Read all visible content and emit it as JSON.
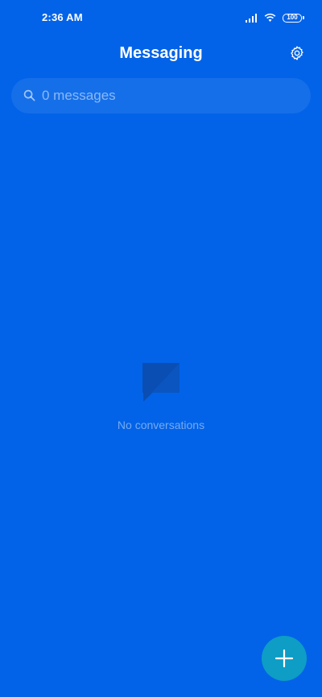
{
  "status_bar": {
    "time": "2:36 AM",
    "battery_level": "100",
    "icons": [
      "signal-icon",
      "wifi-icon",
      "battery-icon"
    ]
  },
  "header": {
    "title": "Messaging",
    "settings_icon": "gear-icon"
  },
  "search": {
    "placeholder": "0 messages",
    "icon": "search-icon"
  },
  "empty_state": {
    "icon": "message-bubble-icon",
    "text": "No conversations"
  },
  "fab": {
    "icon": "plus-icon"
  },
  "colors": {
    "background": "#0263e8",
    "fab": "#0e9dc4",
    "text": "#ffffff"
  }
}
